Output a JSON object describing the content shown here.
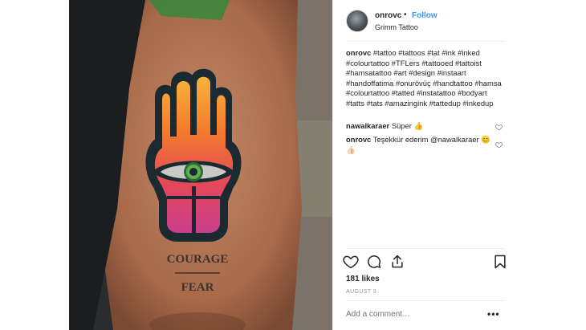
{
  "post": {
    "username": "onrovc",
    "separator": "•",
    "follow_label": "Follow",
    "location": "Grimm Tattoo",
    "photo_alt": "Hamsa hand tattoo",
    "tattoo_words": {
      "top": "COURAGE",
      "bottom": "FEAR"
    }
  },
  "caption": {
    "username": "onrovc",
    "text": "#tattoo #tattoos #tat #ink #inked #colourtattoo #TFLers #tattooed #tattoist #hamsatattoo #art #design #instaart #handoffatima #onurövüç #handtattoo #hamsa #colourtattoo #tatted #instatattoo #bodyart #tatts #tats #amazingink #tattedup #inkedup"
  },
  "comments": [
    {
      "username": "nawalkaraer",
      "text": "Süper 👍"
    },
    {
      "username": "onrovc",
      "text": "Teşekkür ederim @nawalkaraer 😊👍🏻"
    }
  ],
  "stats": {
    "likes": "181 likes",
    "date": "AUGUST 3"
  },
  "add_comment": {
    "placeholder": "Add a comment…",
    "more_label": "•••"
  },
  "colors": {
    "link": "#3897f0",
    "text": "#262626",
    "muted": "#999999"
  },
  "icons": [
    "heart-icon",
    "comment-icon",
    "share-icon",
    "bookmark-icon",
    "small-heart-icon"
  ]
}
